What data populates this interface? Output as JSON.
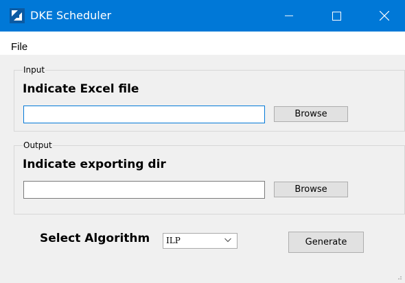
{
  "window": {
    "title": "DKE Scheduler",
    "icon": "app-logo-icon",
    "controls": [
      "minimize-icon",
      "maximize-icon",
      "close-icon"
    ]
  },
  "menu": {
    "file": "File"
  },
  "input_group": {
    "legend": "Input",
    "heading": "Indicate Excel file",
    "path_value": "",
    "browse_label": "Browse"
  },
  "output_group": {
    "legend": "Output",
    "heading": "Indicate exporting dir",
    "path_value": "",
    "browse_label": "Browse"
  },
  "algorithm": {
    "label": "Select Algorithm",
    "selected": "ILP"
  },
  "generate_label": "Generate",
  "colors": {
    "titlebar": "#0078d7",
    "focus_border": "#0078d7"
  }
}
